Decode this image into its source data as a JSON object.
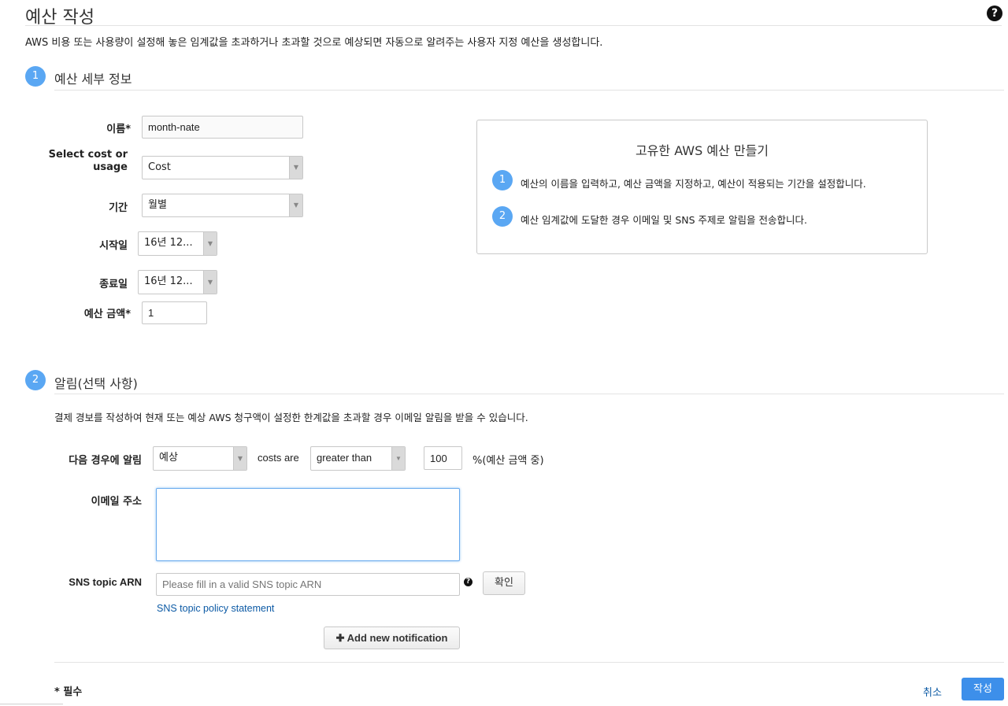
{
  "header": {
    "title": "예산 작성",
    "help_icon": "question-circle-icon",
    "description": "AWS 비용 또는 사용량이 설정해 놓은 임계값을 초과하거나 초과할 것으로 예상되면 자동으로 알려주는 사용자 지정 예산을 생성합니다."
  },
  "section1": {
    "number": "1",
    "title": "예산 세부 정보",
    "fields": {
      "name_label": "이름*",
      "name_value": "month-nate",
      "cost_usage_label_line1": "Select cost or",
      "cost_usage_label_line2": "usage",
      "cost_usage_value": "Cost",
      "period_label": "기간",
      "period_value": "월별",
      "start_label": "시작일",
      "start_value": "16년 12...",
      "end_label": "종료일",
      "end_value": "16년 12...",
      "amount_label": "예산 금액*",
      "amount_value": "1"
    }
  },
  "info_box": {
    "title": "고유한 AWS 예산 만들기",
    "steps": [
      {
        "number": "1",
        "text": "예산의 이름을 입력하고, 예산 금액을 지정하고, 예산이 적용되는 기간을 설정합니다."
      },
      {
        "number": "2",
        "text": "예산 임계값에 도달한 경우 이메일 및 SNS 주제로 알림을 전송합니다."
      }
    ]
  },
  "section2": {
    "number": "2",
    "title": "알림(선택 사항)",
    "description": "결제 경보를 작성하여 현재 또는 예상 AWS 청구액이 설정한 한계값을 초과할 경우 이메일 알림을 받을 수 있습니다.",
    "notify_label": "다음 경우에 알림",
    "notify_type": "예상",
    "costs_are": "costs are",
    "comparison": "greater than",
    "threshold": "100",
    "percent_suffix": "%(예산 금액 중)",
    "email_label": "이메일 주소",
    "email_value": "",
    "sns_label": "SNS topic ARN",
    "sns_placeholder": "Please fill in a valid SNS topic ARN",
    "sns_help_icon": "question-circle-icon",
    "verify_button": "확인",
    "sns_policy_link": "SNS topic policy statement",
    "add_notification_button": "Add new notification",
    "add_icon": "plus-icon"
  },
  "footer": {
    "required_note": "* 필수",
    "cancel": "취소",
    "create": "작성"
  },
  "colors": {
    "accent": "#3d8fea",
    "badge": "#5aa7f3",
    "link": "#0c5aa5"
  }
}
